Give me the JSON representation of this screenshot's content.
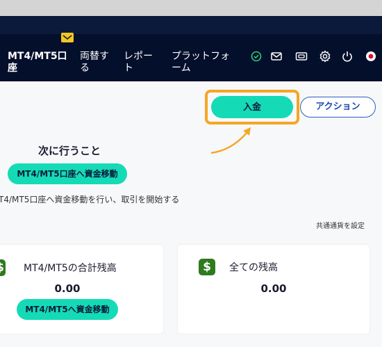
{
  "nav": {
    "items": [
      {
        "label": "MT4/MT5口座"
      },
      {
        "label": "両替する"
      },
      {
        "label": "レポート"
      },
      {
        "label": "プラットフォーム"
      }
    ],
    "icons": [
      "check-circle-icon",
      "mail-icon",
      "card-icon",
      "gear-icon",
      "power-icon",
      "flag-icon"
    ]
  },
  "toolbar": {
    "deposit_label": "入金",
    "action_label": "アクション"
  },
  "next_steps": {
    "title": "次に行うこと",
    "button_label": "MT4/MT5口座へ資金移動",
    "description": "T4/MT5口座へ資金移動を行い、取引を開始する"
  },
  "currency_link": "共通通貨を設定",
  "cards": {
    "mt_total": {
      "title": "MT4/MT5の合計残高",
      "value": "0.00",
      "button_label": "MT4/MT5へ資金移動"
    },
    "all_balance": {
      "title": "全ての残高",
      "value": "0.00"
    }
  },
  "colors": {
    "nav_bg": "#040f2b",
    "accent": "#14dbb6",
    "highlight": "#f5a623",
    "action_border": "#2b5cc4",
    "dollar": "#2f7a1f"
  }
}
